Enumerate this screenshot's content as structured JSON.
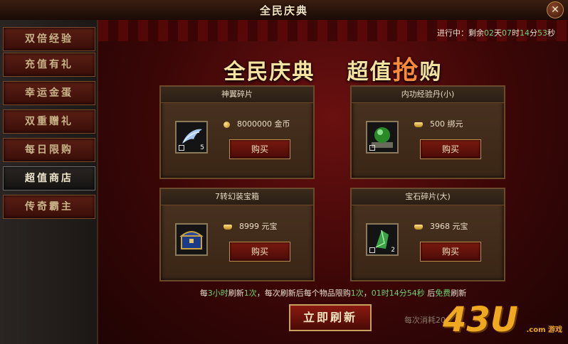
{
  "window": {
    "title": "全民庆典",
    "close_label": "✕"
  },
  "sidebar": {
    "items": [
      {
        "label": "双倍经验"
      },
      {
        "label": "充值有礼"
      },
      {
        "label": "幸运金蛋"
      },
      {
        "label": "双重赠礼"
      },
      {
        "label": "每日限购"
      },
      {
        "label": "超值商店"
      },
      {
        "label": "传奇霸主"
      }
    ],
    "active_index": 5
  },
  "countdown": {
    "prefix": "进行中：剩余",
    "days": "02",
    "days_unit": "天",
    "hours": "07",
    "hours_unit": "时",
    "minutes": "14",
    "minutes_unit": "分",
    "seconds": "53",
    "seconds_unit": "秒"
  },
  "banner": {
    "left": "全民庆典",
    "right_a": "超值",
    "right_hl": "抢",
    "right_b": "购"
  },
  "items": [
    {
      "name": "神翼碎片",
      "count": "5",
      "price": "8000000",
      "currency": "金币",
      "currency_icon": "coin-icon",
      "buy_label": "购买"
    },
    {
      "name": "内功经验丹(小)",
      "count": "",
      "price": "500",
      "currency": "绑元",
      "currency_icon": "ingot-icon",
      "buy_label": "购买"
    },
    {
      "name": "7转幻装宝箱",
      "count": "",
      "price": "8999",
      "currency": "元宝",
      "currency_icon": "ingot-icon",
      "buy_label": "购买"
    },
    {
      "name": "宝石碎片(大)",
      "count": "2",
      "price": "3968",
      "currency": "元宝",
      "currency_icon": "ingot-icon",
      "buy_label": "购买"
    }
  ],
  "refresh": {
    "p1": "每",
    "n1": "3小时",
    "p2": "刷新",
    "n2": "1次",
    "p3": "，每次刷新后每个物品限购",
    "n3": "1次",
    "p4": "，",
    "timer": "01时14分54秒",
    "p5": " 后",
    "free": "免费",
    "p6": "刷新",
    "button_label": "立即刷新",
    "cost_note": "每次消耗20"
  },
  "logo": {
    "big": "43U",
    "small": ".com  游戏"
  }
}
